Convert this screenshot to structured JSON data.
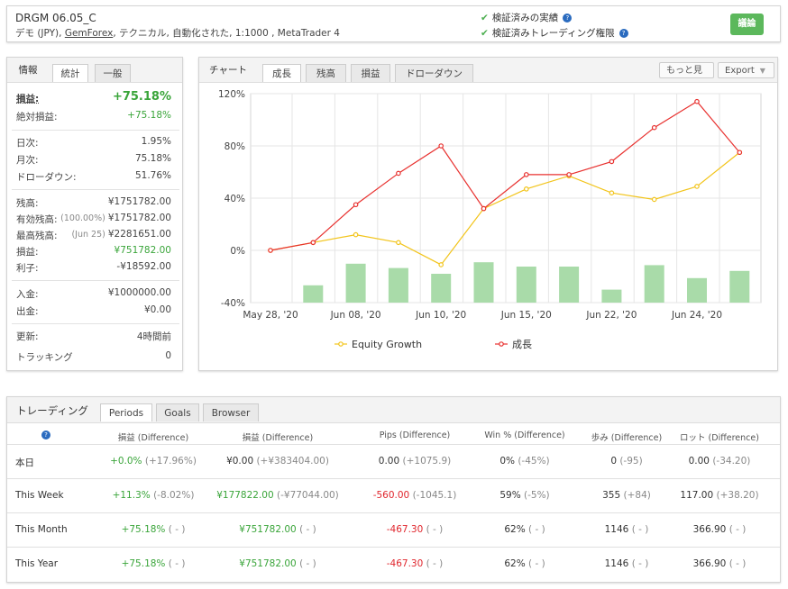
{
  "header": {
    "account_name": "DRGM 06.05_C",
    "info_prefix": "デモ (JPY), ",
    "broker": "GemForex",
    "info_suffix": ", テクニカル, 自動化された, 1:1000 , MetaTrader 4",
    "verified_track": "検証済みの実績",
    "verified_trading": "検証済みトレーディング権限",
    "discuss_label": "議論",
    "help_glyph": "?"
  },
  "stats": {
    "tabs": [
      "情報",
      "統計",
      "一般"
    ],
    "rows": [
      {
        "label": "損益:",
        "value": "+75.18%"
      },
      {
        "label": "絶対損益:",
        "value": "+75.18%"
      },
      {
        "label": "日次:",
        "value": "1.95%"
      },
      {
        "label": "月次:",
        "value": "75.18%"
      },
      {
        "label": "ドローダウン:",
        "value": "51.76%"
      },
      {
        "label": "残高:",
        "value": "¥1751782.00"
      },
      {
        "label": "有効残高:",
        "sub": "(100.00%)",
        "value": "¥1751782.00"
      },
      {
        "label": "最高残高:",
        "sub": "(Jun 25)",
        "value": "¥2281651.00"
      },
      {
        "label": "損益:",
        "value": "¥751782.00"
      },
      {
        "label": "利子:",
        "value": "-¥18592.00"
      },
      {
        "label": "入金:",
        "value": "¥1000000.00"
      },
      {
        "label": "出金:",
        "value": "¥0.00"
      },
      {
        "label": "更新:",
        "value": "4時間前"
      },
      {
        "label": "トラッキング",
        "value": "0"
      }
    ]
  },
  "chart": {
    "tabs": [
      "チャート",
      "成長",
      "残高",
      "損益",
      "ドローダウン"
    ],
    "more_label": "もっと見",
    "export_label": "Export",
    "colors": {
      "growth": "#e8312f",
      "equity": "#f2c41a",
      "bars": "#a9dba9",
      "axis": "#999999",
      "grid": "#e5e5e5"
    }
  },
  "chart_data": {
    "type": "line",
    "title": "",
    "xlabel": "",
    "ylabel": "",
    "ylim": [
      -40,
      120
    ],
    "yticks": [
      "120%",
      "80%",
      "40%",
      "0%",
      "-40%"
    ],
    "xtick_labels": [
      "May 28, '20",
      "Jun 08, '20",
      "Jun 10, '20",
      "Jun 15, '20",
      "Jun 22, '20",
      "Jun 24, '20"
    ],
    "series": [
      {
        "name": "Equity Growth",
        "values": [
          0,
          6,
          12,
          6,
          -11,
          32,
          47,
          57,
          44,
          39,
          49,
          75
        ]
      },
      {
        "name": "成長",
        "values": [
          0,
          6,
          35,
          59,
          80,
          32,
          58,
          58,
          68,
          94,
          114,
          75
        ]
      }
    ],
    "bars": [
      null,
      12,
      27,
      24,
      20,
      28,
      25,
      25,
      9,
      26,
      17,
      22
    ],
    "legend_position": "bottom"
  },
  "trading": {
    "title": "トレーディング",
    "tabs": [
      "Periods",
      "Goals",
      "Browser"
    ],
    "help_glyph": "?",
    "columns": [
      "損益 (Difference)",
      "損益 (Difference)",
      "Pips (Difference)",
      "Win % (Difference)",
      "歩み (Difference)",
      "ロット (Difference)"
    ],
    "rows": [
      {
        "label": "本日",
        "cells": [
          [
            "+0.0%",
            "(+17.96%)"
          ],
          [
            "¥0.00",
            "(+¥383404.00)"
          ],
          [
            "0.00",
            "(+1075.9)"
          ],
          [
            "0%",
            "(-45%)"
          ],
          [
            "0",
            "(-95)"
          ],
          [
            "0.00",
            "(-34.20)"
          ]
        ]
      },
      {
        "label": "This Week",
        "cells": [
          [
            "+11.3%",
            "(-8.02%)"
          ],
          [
            "¥177822.00",
            "(-¥77044.00)"
          ],
          [
            "-560.00",
            "(-1045.1)"
          ],
          [
            "59%",
            "(-5%)"
          ],
          [
            "355",
            "(+84)"
          ],
          [
            "117.00",
            "(+38.20)"
          ]
        ]
      },
      {
        "label": "This Month",
        "cells": [
          [
            "+75.18%",
            "( - )"
          ],
          [
            "¥751782.00",
            "( - )"
          ],
          [
            "-467.30",
            "( - )"
          ],
          [
            "62%",
            "( - )"
          ],
          [
            "1146",
            "( - )"
          ],
          [
            "366.90",
            "( - )"
          ]
        ]
      },
      {
        "label": "This Year",
        "cells": [
          [
            "+75.18%",
            "( - )"
          ],
          [
            "¥751782.00",
            "( - )"
          ],
          [
            "-467.30",
            "( - )"
          ],
          [
            "62%",
            "( - )"
          ],
          [
            "1146",
            "( - )"
          ],
          [
            "366.90",
            "( - )"
          ]
        ]
      }
    ]
  }
}
